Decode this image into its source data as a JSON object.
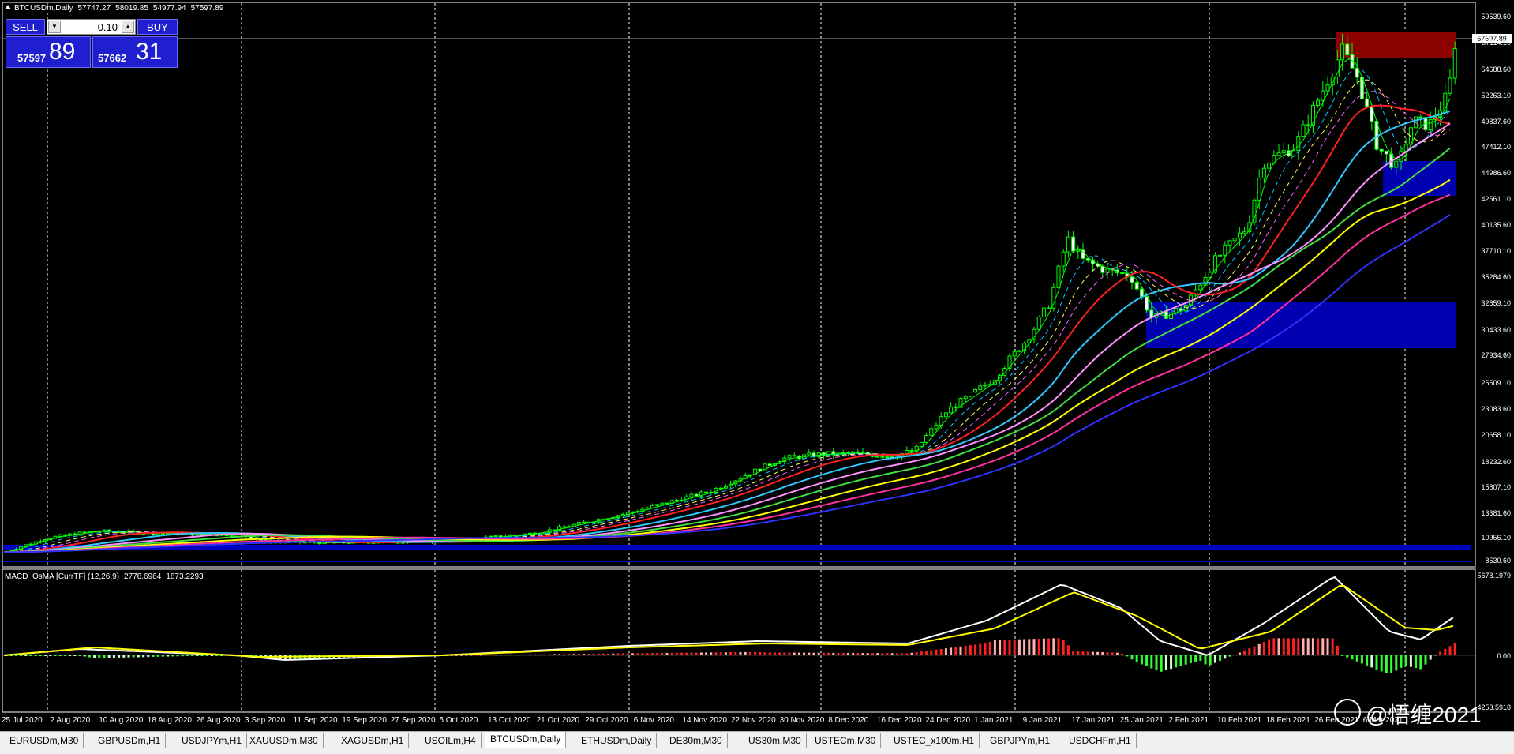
{
  "chart": {
    "symbol_title": "BTCUSDm,Daily",
    "ohlc": [
      "57747.27",
      "58019.85",
      "54977.94",
      "57597.89"
    ],
    "current_price": "57597.89",
    "indicator_title": "MACD_OsMA [CurrTF] (12,26,9)",
    "indicator_values": [
      "2778.6964",
      "1873.2293"
    ]
  },
  "one_click": {
    "sell_label": "SELL",
    "buy_label": "BUY",
    "lot": "0.10",
    "bid_small": "57597",
    "bid_big": "89",
    "ask_small": "57662",
    "ask_big": "31"
  },
  "price_axis": [
    "59539.60",
    "57114.10",
    "54688.60",
    "52263.10",
    "49837.60",
    "47412.10",
    "44986.60",
    "42561.10",
    "40135.60",
    "37710.10",
    "35284.60",
    "32859.10",
    "30433.60",
    "27934.60",
    "25509.10",
    "23083.60",
    "20658.10",
    "18232.60",
    "15807.10",
    "13381.60",
    "10956.10",
    "8530.60"
  ],
  "macd_axis": [
    "5678.1979",
    "0.00",
    "-4253.5918"
  ],
  "date_axis": [
    "25 Jul 2020",
    "2 Aug 2020",
    "10 Aug 2020",
    "18 Aug 2020",
    "26 Aug 2020",
    "3 Sep 2020",
    "11 Sep 2020",
    "19 Sep 2020",
    "27 Sep 2020",
    "5 Oct 2020",
    "13 Oct 2020",
    "21 Oct 2020",
    "29 Oct 2020",
    "6 Nov 2020",
    "14 Nov 2020",
    "22 Nov 2020",
    "30 Nov 2020",
    "8 Dec 2020",
    "16 Dec 2020",
    "24 Dec 2020",
    "1 Jan 2021",
    "9 Jan 2021",
    "17 Jan 2021",
    "25 Jan 2021",
    "2 Feb 2021",
    "10 Feb 2021",
    "18 Feb 2021",
    "26 Feb 2021",
    "6 Mar 2021"
  ],
  "tabs": [
    "EURUSDm,M30",
    "GBPUSDm,H1",
    "USDJPYm,H1",
    "XAUUSDm,M30",
    "XAGUSDm,H1",
    "USOILm,H4",
    "BTCUSDm,Daily",
    "ETHUSDm,Daily",
    "DE30m,M30",
    "US30m,M30",
    "USTECm,M30",
    "USTEC_x100m,H1",
    "GBPJPYm,H1",
    "USDCHFm,H1"
  ],
  "active_tab": "BTCUSDm,Daily",
  "watermark": "@悟缠2021",
  "colors": {
    "bull": "#00ff00",
    "zone_red": "#8b0000",
    "zone_blue": "#0000b0",
    "macd_line": "#ffffff",
    "signal_line": "#ffff00",
    "hist_pos": "#ff2020",
    "hist_neg": "#30ff30"
  }
}
